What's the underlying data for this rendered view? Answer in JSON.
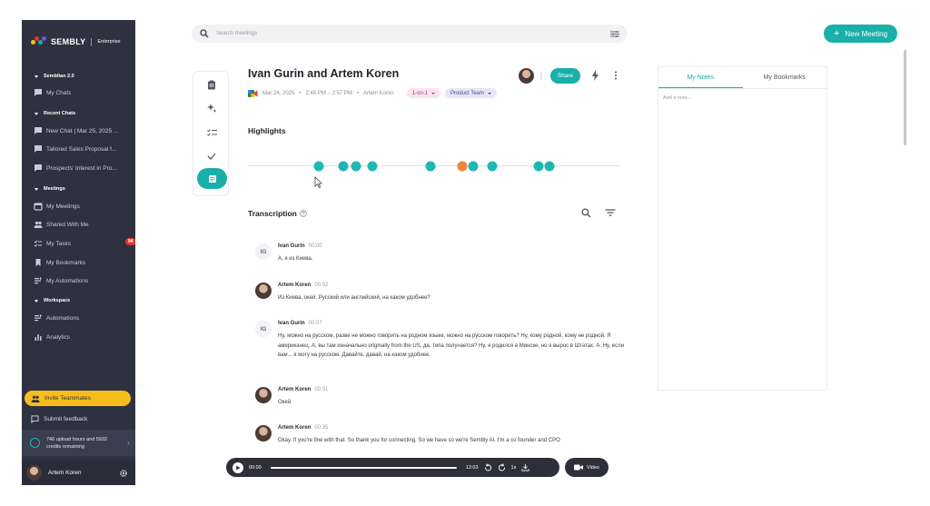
{
  "app": {
    "logo": "SEMBLY",
    "plan": "Enterprise",
    "logo_colors": [
      "#f7bd1c",
      "#e5332a",
      "#1aafa8",
      "#6a5be3"
    ]
  },
  "sidebar": {
    "sembian_section": "Semblian 2.0",
    "my_chats": "My Chats",
    "recent_chats_section": "Recent Chats",
    "recent_chats": [
      "New Chat | Mar 25, 2025 ...",
      "Tailored Sales Proposal f...",
      "Prospects' Interest in Pro..."
    ],
    "meetings_section": "Meetings",
    "meetings_items": [
      {
        "label": "My Meetings",
        "icon": "calendar-icon"
      },
      {
        "label": "Shared With Me",
        "icon": "people-icon"
      },
      {
        "label": "My Tasks",
        "icon": "tasks-icon",
        "badge": "94"
      },
      {
        "label": "My Bookmarks",
        "icon": "bookmark-icon"
      },
      {
        "label": "My Automations",
        "icon": "automation-icon"
      }
    ],
    "workspace_section": "Workspace",
    "workspace_items": [
      {
        "label": "Automations",
        "icon": "automation-icon"
      },
      {
        "label": "Analytics",
        "icon": "analytics-icon"
      }
    ],
    "invite": "Invite Teammates",
    "feedback": "Submit feedback",
    "credits": "746 upload hours and 5932 credits remaining",
    "user_name": "Artem Koren"
  },
  "search": {
    "placeholder": "Search meetings"
  },
  "new_meeting": "New Meeting",
  "meeting": {
    "title": "Ivan Gurin and Artem Koren",
    "date": "Mar 24, 2025",
    "time": "2:45 PM – 2:57 PM",
    "owner": "Artem Koren",
    "tags": [
      "1-on-1",
      "Product Team"
    ],
    "share": "Share"
  },
  "highlights": {
    "title": "Highlights",
    "markers": [
      {
        "position": 0.19,
        "color": "teal"
      },
      {
        "position": 0.255,
        "color": "teal"
      },
      {
        "position": 0.29,
        "color": "teal"
      },
      {
        "position": 0.335,
        "color": "teal"
      },
      {
        "position": 0.49,
        "color": "teal"
      },
      {
        "position": 0.575,
        "color": "orange"
      },
      {
        "position": 0.605,
        "color": "teal"
      },
      {
        "position": 0.655,
        "color": "teal"
      },
      {
        "position": 0.78,
        "color": "teal"
      },
      {
        "position": 0.81,
        "color": "teal"
      }
    ]
  },
  "transcription": {
    "title": "Transcription",
    "entries": [
      {
        "speaker": "Ivan Gurin",
        "initials": "IG",
        "time": "00:00",
        "text": "А, я из Киева."
      },
      {
        "speaker": "Artem Koren",
        "initials": "",
        "time": "00:02",
        "text": "Из Киева, окей. Русский или английский, на каком удобнее?"
      },
      {
        "speaker": "Ivan Gurin",
        "initials": "IG",
        "time": "00:07",
        "text": "Ну, можно на русском, разве не можно говорить на родном языке, можно на русском говорить? Ну, кому родной, кому не родной. Я американец. А, вы там изначально originally from the US, да, типа получается? Ну, я родился в Минске, но я вырос в Штатах. А. Ну, если вам... я могу на русском. Давайте, давай, на каком удобнее."
      },
      {
        "speaker": "Artem Koren",
        "initials": "",
        "time": "00:31",
        "text": "Окей."
      },
      {
        "speaker": "Artem Koren",
        "initials": "",
        "time": "00:35",
        "text": "Okay. If you're fine with that. So thank you for connecting. So we have so we're Sembly AI. I'm a co founder and CPO"
      }
    ]
  },
  "player": {
    "current": "00:00",
    "duration": "12:03",
    "speed": "1x",
    "progress": 0.0,
    "video": "Video"
  },
  "notes": {
    "tabs": [
      "My Notes",
      "My Bookmarks"
    ],
    "placeholder": "Add a note..."
  }
}
